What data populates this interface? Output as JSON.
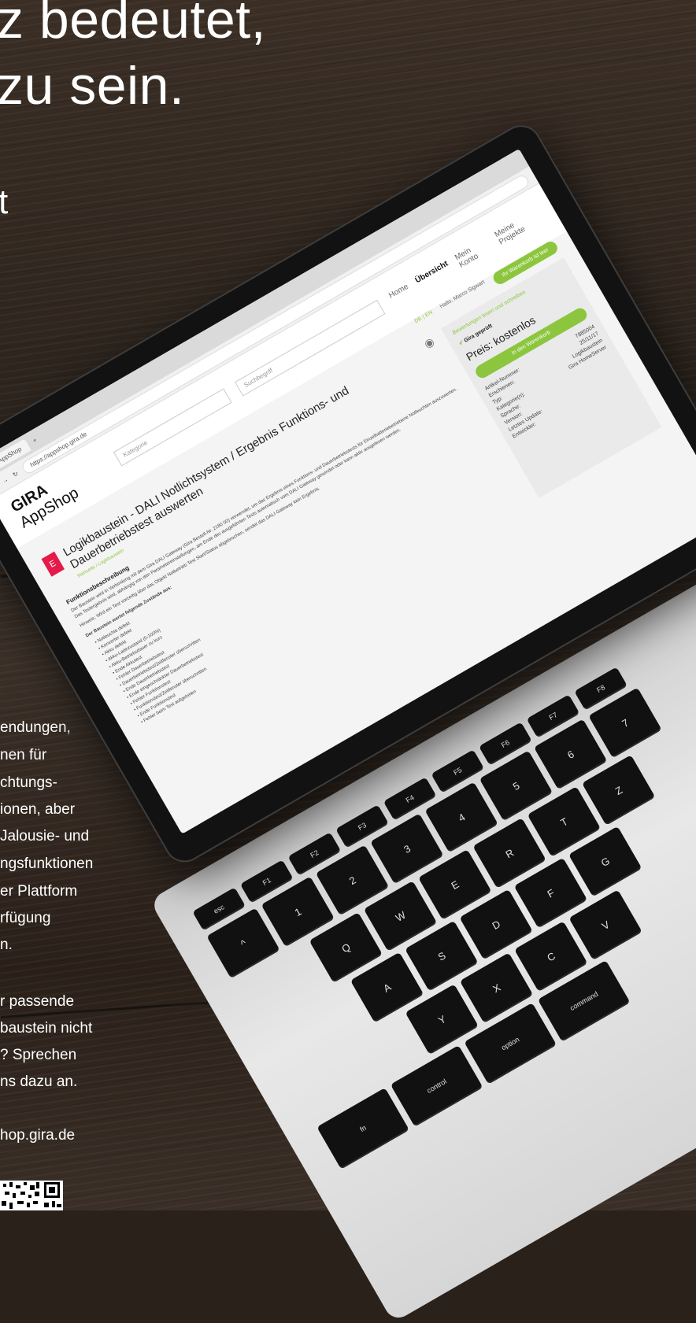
{
  "headline": {
    "line1": "z bedeutet,",
    "line2": "zu sein.",
    "line3": "t"
  },
  "body": {
    "para1": [
      "endungen,",
      "nen für",
      "chtungs-",
      "ionen, aber",
      "Jalousie- und",
      "ngsfunktionen",
      "er Plattform",
      "rfügung",
      "n."
    ],
    "para2": [
      "r passende",
      "baustein nicht",
      "? Sprechen",
      "ns dazu an."
    ],
    "url": "hop.gira.de"
  },
  "screen": {
    "tab_label": "Gira AppShop",
    "address": "https://appshop.gira.de",
    "logo_brand": "GIRA",
    "logo_product": "AppShop",
    "category_placeholder": "Kategorie",
    "search_placeholder": "Suchbegriff",
    "nav": [
      "Home",
      "Übersicht",
      "Mein Konto",
      "Meine Projekte"
    ],
    "lang": "DE | EN",
    "greeting": "Hallo, Marco Sigwart",
    "cart_button": "Ihr Warenkorb ist leer",
    "product_icon": "E",
    "product_title": "Logikbaustein - DALI Notlichtsystem / Ergebnis Funktions- und Dauerbetriebstest auswerten",
    "breadcrumb": "Startseite / Logikbaustein",
    "section_title": "Funktionsbeschreibung",
    "description": "Der Baustein wird in Verbindung mit dem Gira DALI Gateway (Gira Bestell-Nr. 2180 00) verwendet, um das Ergebnis eines Funktions- und Dauerbetriebstests für Einzelbatteriebetriebene Notleuchten auszuwerten. Das Testergebnis wird, abhängig von den Parametereinstellungen, am Ende des ausgeführten Tests automatisch vom DALI Gateway gesendet oder kann aktiv ausgelesen werden.",
    "note": "Hinweis: Wird ein Test vorzeitig über das Objekt Notbetrieb Test Start/Status abgebrochen, sendet das DALI Gateway kein Ergebnis.",
    "states_title": "Der Baustein wertet folgende Zustände aus:",
    "states": [
      "Notleuchte defekt",
      "Konverter defekt",
      "Akku defekt",
      "Akku-Ladezustand (0-100%)",
      "Akku-Betriebsdauer zu kurz",
      "Ende Akkutest",
      "Fehler Dauerbetriebstest",
      "Dauerbetriebstest/Zeitfenster überschritten",
      "Ende Dauerbetriebstest",
      "Ende eingeschränkter Dauerbetriebstest",
      "Fehler Funktionstest",
      "Funktionstest/Zeitfenster überschritten",
      "Ende Funktionstest",
      "Fehler beim Test aufgetreten"
    ],
    "rating_link": "Bewertungen lesen und schreiben",
    "verified": "Gira geprüft",
    "price": "Preis: kostenlos",
    "add_to_cart": "In den Warenkorb",
    "meta": [
      {
        "label": "Artikel-Nummer:",
        "value": "7885004"
      },
      {
        "label": "Erschienen:",
        "value": "25/11/17"
      },
      {
        "label": "Typ:",
        "value": "Logikbaustein"
      },
      {
        "label": "Kategorie(n):",
        "value": "Gira HomeServer"
      },
      {
        "label": "Sprache:",
        "value": ""
      },
      {
        "label": "Version:",
        "value": ""
      },
      {
        "label": "Letztes Update:",
        "value": ""
      },
      {
        "label": "Entwickler:",
        "value": ""
      }
    ]
  },
  "keyboard": {
    "row1": [
      "esc",
      "F1",
      "F2",
      "F3",
      "F4",
      "F5",
      "F6",
      "F7",
      "F8"
    ],
    "row2": [
      "^",
      "1",
      "2",
      "3",
      "4",
      "5",
      "6",
      "7"
    ],
    "row3": [
      "Q",
      "W",
      "E",
      "R",
      "T",
      "Z"
    ],
    "row4": [
      "A",
      "S",
      "D",
      "F",
      "G"
    ],
    "row5": [
      "Y",
      "X",
      "C",
      "V"
    ],
    "mods": [
      "fn",
      "control",
      "option",
      "command"
    ]
  }
}
